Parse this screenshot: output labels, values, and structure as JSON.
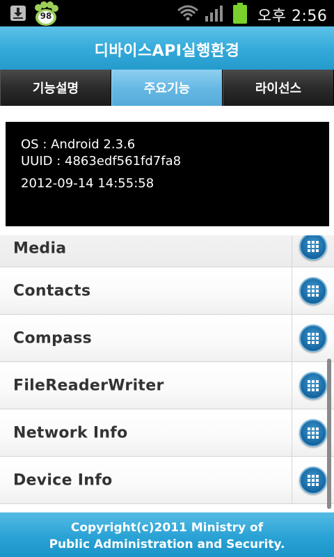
{
  "status_bar": {
    "notification_badge": "98",
    "time": "오후 2:56",
    "icons": [
      "download-icon",
      "paw-notification-icon",
      "wifi-icon",
      "signal-icon",
      "battery-icon"
    ]
  },
  "app": {
    "title": "디바이스API실행환경"
  },
  "tabs": [
    {
      "label": "기능설명",
      "active": false
    },
    {
      "label": "주요기능",
      "active": true
    },
    {
      "label": "라이선스",
      "active": false
    }
  ],
  "info": {
    "os": "OS : Android 2.3.6",
    "uuid": "UUID : 4863edf561fd7fa8",
    "datetime": "2012-09-14 14:55:58"
  },
  "list": {
    "items": [
      {
        "label": "Media",
        "icon": "grid-icon"
      },
      {
        "label": "Contacts",
        "icon": "grid-icon"
      },
      {
        "label": "Compass",
        "icon": "grid-icon"
      },
      {
        "label": "FileReaderWriter",
        "icon": "grid-icon"
      },
      {
        "label": "Network Info",
        "icon": "grid-icon"
      },
      {
        "label": "Device Info",
        "icon": "grid-icon"
      }
    ]
  },
  "footer": {
    "line1": "Copyright(c)2011 Ministry of",
    "line2": "Public Administration and Security."
  },
  "colors": {
    "title_bar": "#33a9d9",
    "active_tab": "#67b9e4",
    "row_button": "#1a6ca6"
  }
}
